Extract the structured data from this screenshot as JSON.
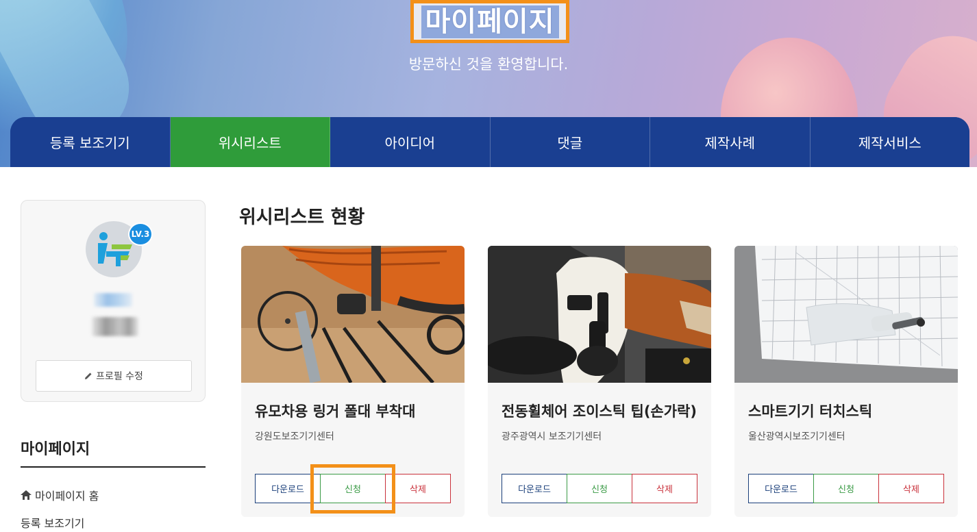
{
  "hero": {
    "title": "마이페이지",
    "subtitle": "방문하신 것을 환영합니다."
  },
  "tabs": [
    {
      "label": "등록 보조기기",
      "active": false
    },
    {
      "label": "위시리스트",
      "active": true
    },
    {
      "label": "아이디어",
      "active": false
    },
    {
      "label": "댓글",
      "active": false
    },
    {
      "label": "제작사례",
      "active": false
    },
    {
      "label": "제작서비스",
      "active": false
    }
  ],
  "profile": {
    "level_badge": "LV.3",
    "edit_label": "프로필 수정",
    "edit_icon": "pencil-icon"
  },
  "sidebar": {
    "title": "마이페이지",
    "links": [
      {
        "label": "마이페이지 홈",
        "icon": "home-icon"
      },
      {
        "label": "등록 보조기기"
      }
    ]
  },
  "main": {
    "title": "위시리스트 현황"
  },
  "cards": [
    {
      "title": "유모차용 링거 폴대 부착대",
      "org": "강원도보조기기센터",
      "image": "stroller-iv-pole-mount-photo"
    },
    {
      "title": "전동휠체어 조이스틱 팁(손가락)",
      "org": "광주광역시 보조기기센터",
      "image": "wheelchair-joystick-tip-photo"
    },
    {
      "title": "스마트기기 터치스틱",
      "org": "울산광역시보조기기센터",
      "image": "touch-stick-on-cutting-mat-photo"
    }
  ],
  "card_buttons": {
    "download": "다운로드",
    "apply": "신청",
    "delete": "삭제"
  },
  "colors": {
    "tab_bg": "#1a3f91",
    "tab_active": "#2f9c3a",
    "highlight": "#f39019",
    "download": "#1a3f7a",
    "apply": "#3a9a45",
    "delete": "#c9303a"
  }
}
